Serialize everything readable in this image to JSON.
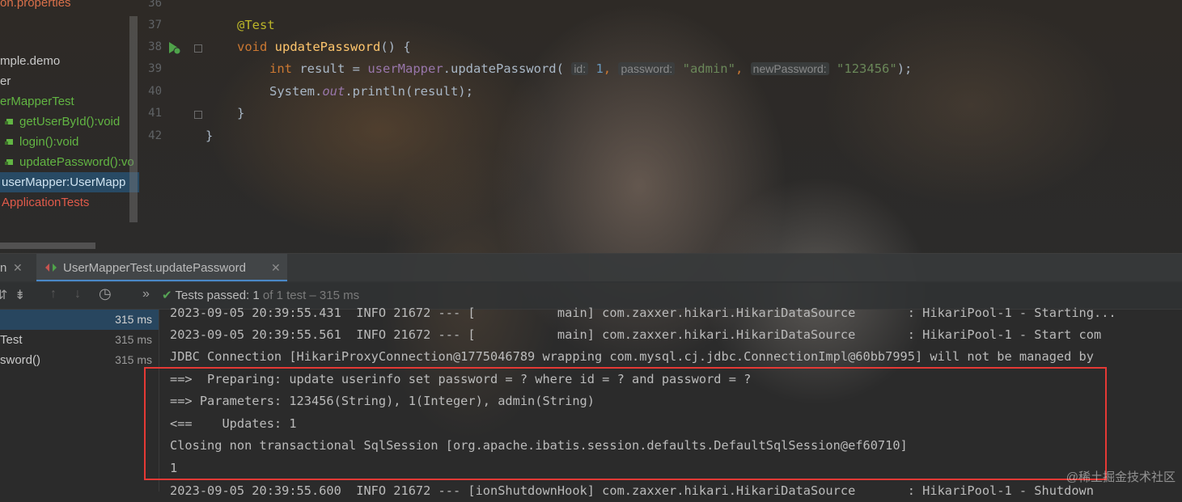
{
  "project_tree": {
    "items": [
      {
        "label": "on.properties",
        "style": "props"
      },
      {
        "label": "",
        "style": "plain"
      },
      {
        "label": "mple.demo",
        "style": "plain"
      },
      {
        "label": "er",
        "style": "plain"
      },
      {
        "label": "erMapperTest",
        "style": "green"
      },
      {
        "label": "getUserById():void",
        "style": "green"
      },
      {
        "label": "login():void",
        "style": "green"
      },
      {
        "label": "updatePassword():vo",
        "style": "green"
      },
      {
        "label": "userMapper:UserMapp",
        "style": "selected"
      },
      {
        "label": "ApplicationTests",
        "style": "red"
      }
    ]
  },
  "editor": {
    "line_numbers": [
      "36",
      "37",
      "38",
      "39",
      "40",
      "41",
      "42"
    ],
    "annotation": "@Test",
    "method_return": "void",
    "method_name": "updatePassword",
    "method_tail": "() {",
    "line39": {
      "type": "int",
      "var": " result = ",
      "field": "userMapper",
      "call": ".updatePassword(",
      "hint_id": "id:",
      "arg_id": "1",
      "comma1": ",",
      "hint_pwd": "password:",
      "arg_pwd": "\"admin\"",
      "comma2": ",",
      "hint_new": "newPassword:",
      "arg_new": "\"123456\"",
      "end": ");"
    },
    "line40": {
      "pre": "System.",
      "field": "out",
      "post": ".println(result);"
    },
    "line41": "}",
    "line42": "}"
  },
  "run_window": {
    "tab_left": "n",
    "tab_left_close": "✕",
    "tab_active": "UserMapperTest.updatePassword",
    "tab_active_close": "✕"
  },
  "toolbar": {
    "expand_icon": "⇵",
    "collapse_icon": "⇟",
    "up_icon": "↑",
    "down_icon": "↓",
    "history_icon": "◷",
    "more_icon": "»",
    "status_icon": "✔",
    "status_label": "Tests passed: ",
    "status_count": "1",
    "status_rest": " of 1 test – 315 ms"
  },
  "test_tree": {
    "rows": [
      {
        "name": "",
        "time": "315 ms"
      },
      {
        "name": "Test",
        "time": "315 ms"
      },
      {
        "name": "sword()",
        "time": "315 ms"
      }
    ]
  },
  "console": {
    "lines": [
      "2023-09-05 20:39:55.431  INFO 21672 --- [           main] com.zaxxer.hikari.HikariDataSource       : HikariPool-1 - Starting...",
      "2023-09-05 20:39:55.561  INFO 21672 --- [           main] com.zaxxer.hikari.HikariDataSource       : HikariPool-1 - Start com",
      "JDBC Connection [HikariProxyConnection@1775046789 wrapping com.mysql.cj.jdbc.ConnectionImpl@60bb7995] will not be managed by",
      "==>  Preparing: update userinfo set password = ? where id = ? and password = ?",
      "==> Parameters: 123456(String), 1(Integer), admin(String)",
      "<==    Updates: 1",
      "Closing non transactional SqlSession [org.apache.ibatis.session.defaults.DefaultSqlSession@ef60710]",
      "1",
      "2023-09-05 20:39:55.600  INFO 21672 --- [ionShutdownHook] com.zaxxer.hikari.HikariDataSource       : HikariPool-1 - Shutdown"
    ]
  },
  "watermark": "@稀土掘金技术社区"
}
